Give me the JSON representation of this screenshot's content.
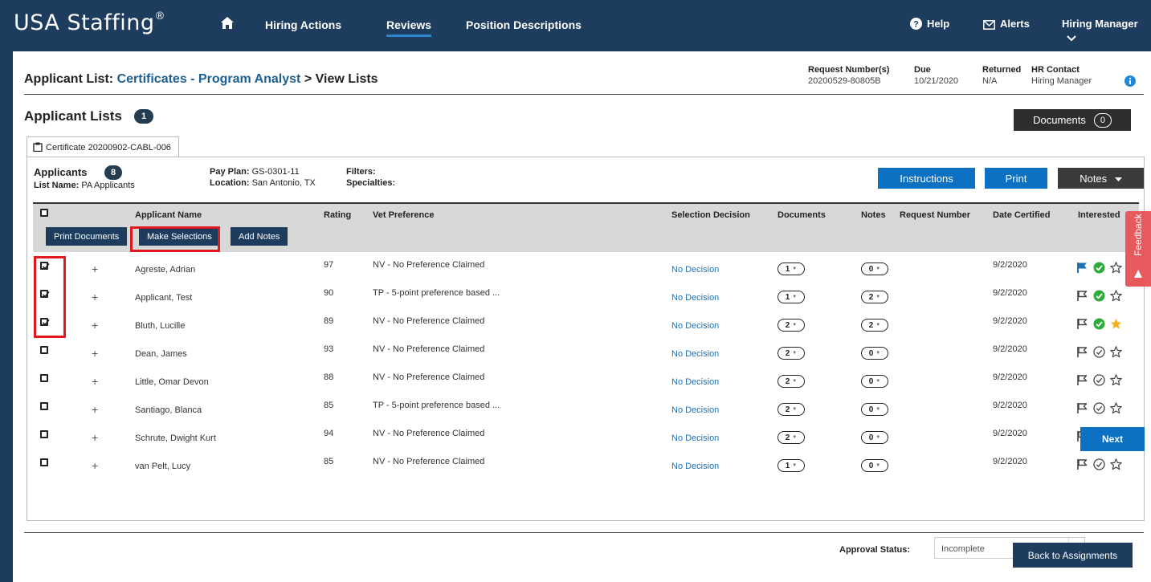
{
  "colors": {
    "nav_bg": "#1d3c5e",
    "accent_blue": "#0c71c3",
    "link_blue": "#1f6fb3",
    "highlight_red": "#e0191e",
    "feedback_red": "#e8595e",
    "check_green": "#2eaa3c",
    "star_gold": "#f2b11a"
  },
  "nav": {
    "brand": "USA Staffing",
    "brand_mark": "®",
    "links": [
      "Hiring Actions",
      "Reviews",
      "Position Descriptions"
    ],
    "active_link": "Reviews",
    "help": "Help",
    "alerts": "Alerts",
    "user": "Hiring Manager"
  },
  "header": {
    "prefix": "Applicant List: ",
    "link": "Certificates - Program Analyst",
    "suffix": " > View Lists",
    "request_label": "Request Number(s)",
    "request_value": "20200529-80805B",
    "due_label": "Due",
    "due_value": "10/21/2020",
    "returned_label": "Returned",
    "returned_value": "N/A",
    "hr_label": "HR Contact",
    "hr_value": "Hiring Manager"
  },
  "lists": {
    "title": "Applicant Lists",
    "count": "1",
    "documents_label": "Documents",
    "documents_count": "0",
    "tab_label": "Certificate 20200902-CABL-006"
  },
  "panel": {
    "applicants_label": "Applicants",
    "applicants_count": "8",
    "list_name_label": "List Name:",
    "list_name_value": "PA Applicants",
    "pay_plan_label": "Pay Plan:",
    "pay_plan_value": "GS-0301-11",
    "location_label": "Location:",
    "location_value": "San Antonio, TX",
    "filters_label": "Filters:",
    "specialties_label": "Specialties:",
    "instructions": "Instructions",
    "print": "Print",
    "notes": "Notes"
  },
  "columns": {
    "name": "Applicant Name",
    "rating": "Rating",
    "vet": "Vet Preference",
    "decision": "Selection Decision",
    "documents": "Documents",
    "notes": "Notes",
    "request": "Request Number",
    "certified": "Date Certified",
    "interested": "Interested"
  },
  "actions": {
    "print_documents": "Print Documents",
    "make_selections": "Make Selections",
    "add_notes": "Add Notes"
  },
  "applicants": [
    {
      "name": "Agreste, Adrian",
      "rating": "97",
      "vet": "NV - No Preference Claimed",
      "decision": "No Decision",
      "docs": "1",
      "notes": "0",
      "certified": "9/2/2020",
      "checked": true,
      "flag": "filled",
      "check": "filled",
      "star": "empty"
    },
    {
      "name": "Applicant, Test",
      "rating": "90",
      "vet": "TP - 5-point preference based ...",
      "decision": "No Decision",
      "docs": "1",
      "notes": "2",
      "certified": "9/2/2020",
      "checked": true,
      "flag": "outline",
      "check": "filled",
      "star": "empty"
    },
    {
      "name": "Bluth, Lucille",
      "rating": "89",
      "vet": "NV - No Preference Claimed",
      "decision": "No Decision",
      "docs": "2",
      "notes": "2",
      "certified": "9/2/2020",
      "checked": true,
      "flag": "outline",
      "check": "filled",
      "star": "filled"
    },
    {
      "name": "Dean, James",
      "rating": "93",
      "vet": "NV - No Preference Claimed",
      "decision": "No Decision",
      "docs": "2",
      "notes": "0",
      "certified": "9/2/2020",
      "checked": false,
      "flag": "outline",
      "check": "outline",
      "star": "empty"
    },
    {
      "name": "Little, Omar Devon",
      "rating": "88",
      "vet": "NV - No Preference Claimed",
      "decision": "No Decision",
      "docs": "2",
      "notes": "0",
      "certified": "9/2/2020",
      "checked": false,
      "flag": "outline",
      "check": "outline",
      "star": "empty"
    },
    {
      "name": "Santiago, Blanca",
      "rating": "85",
      "vet": "TP - 5-point preference based ...",
      "decision": "No Decision",
      "docs": "2",
      "notes": "0",
      "certified": "9/2/2020",
      "checked": false,
      "flag": "outline",
      "check": "outline",
      "star": "empty"
    },
    {
      "name": "Schrute, Dwight Kurt",
      "rating": "94",
      "vet": "NV - No Preference Claimed",
      "decision": "No Decision",
      "docs": "2",
      "notes": "0",
      "certified": "9/2/2020",
      "checked": false,
      "flag": "outline",
      "check": "outline",
      "star": "empty"
    },
    {
      "name": "van Pelt, Lucy",
      "rating": "85",
      "vet": "NV - No Preference Claimed",
      "decision": "No Decision",
      "docs": "1",
      "notes": "0",
      "certified": "9/2/2020",
      "checked": false,
      "flag": "outline",
      "check": "outline",
      "star": "empty"
    }
  ],
  "approval": {
    "label": "Approval Status:",
    "value": "Incomplete",
    "next": "Next"
  },
  "footer": {
    "back": "Back to Assignments"
  },
  "feedback": {
    "label": "Feedback"
  },
  "icons": {
    "home": "home-icon",
    "help": "question-circle-icon",
    "alerts": "envelope-icon",
    "user_menu": "chevron-down-icon",
    "info": "info-circle-icon",
    "tab": "clipboard-icon",
    "flag": "flag-icon",
    "interested": "check-circle-icon",
    "favorite": "star-icon"
  }
}
